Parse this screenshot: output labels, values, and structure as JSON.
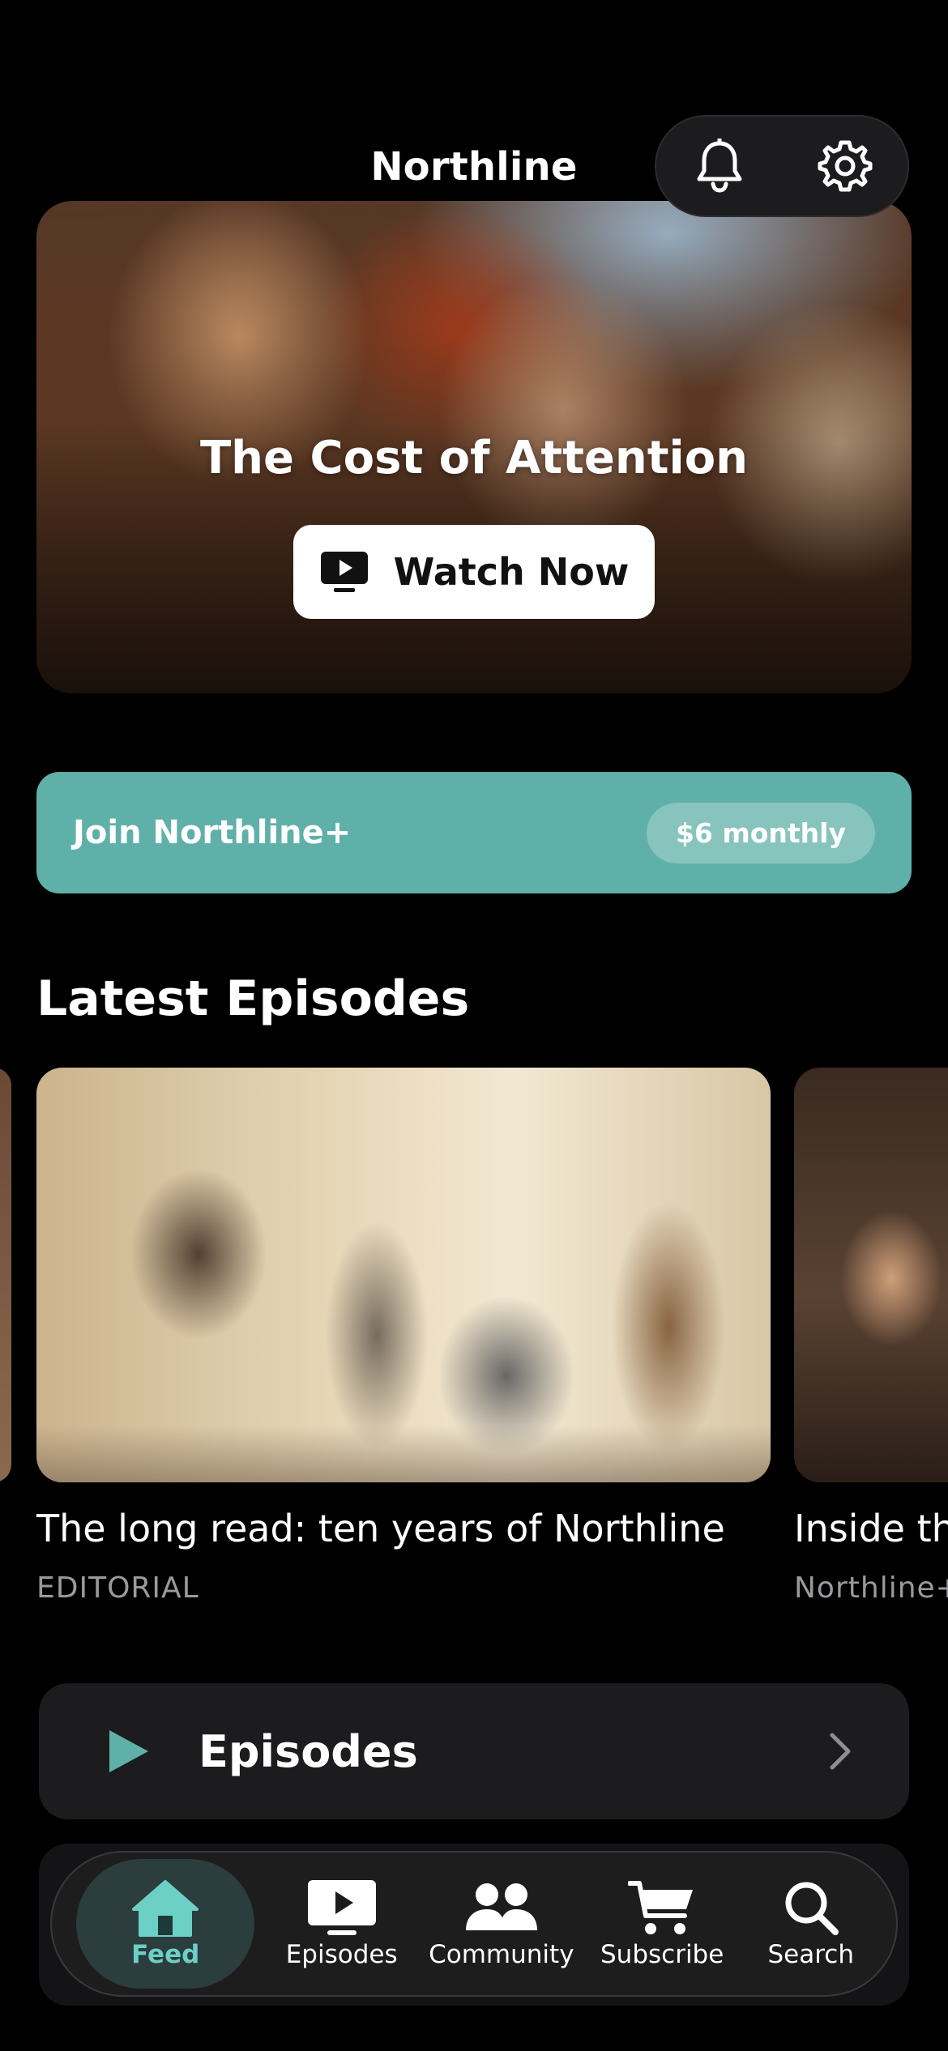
{
  "header": {
    "title": "Northline"
  },
  "hero": {
    "title": "The Cost of Attention",
    "cta_label": "Watch Now"
  },
  "join": {
    "label": "Join Northline+",
    "price": "$6 monthly"
  },
  "latest": {
    "title": "Latest Episodes",
    "cards": [
      {
        "title": "The long read: ten years of Northline",
        "tag": "EDITORIAL"
      },
      {
        "title": "Inside th",
        "tag": "Northline+"
      }
    ]
  },
  "episodes_row": {
    "label": "Episodes"
  },
  "tabbar": {
    "items": [
      {
        "label": "Feed",
        "icon": "home-icon",
        "active": true
      },
      {
        "label": "Episodes",
        "icon": "play-screen-icon"
      },
      {
        "label": "Community",
        "icon": "people-icon"
      },
      {
        "label": "Subscribe",
        "icon": "cart-icon"
      },
      {
        "label": "Search",
        "icon": "search-icon"
      }
    ]
  },
  "colors": {
    "accent": "#5fb0a8",
    "background": "#000000",
    "surface": "#1c1c1e"
  }
}
